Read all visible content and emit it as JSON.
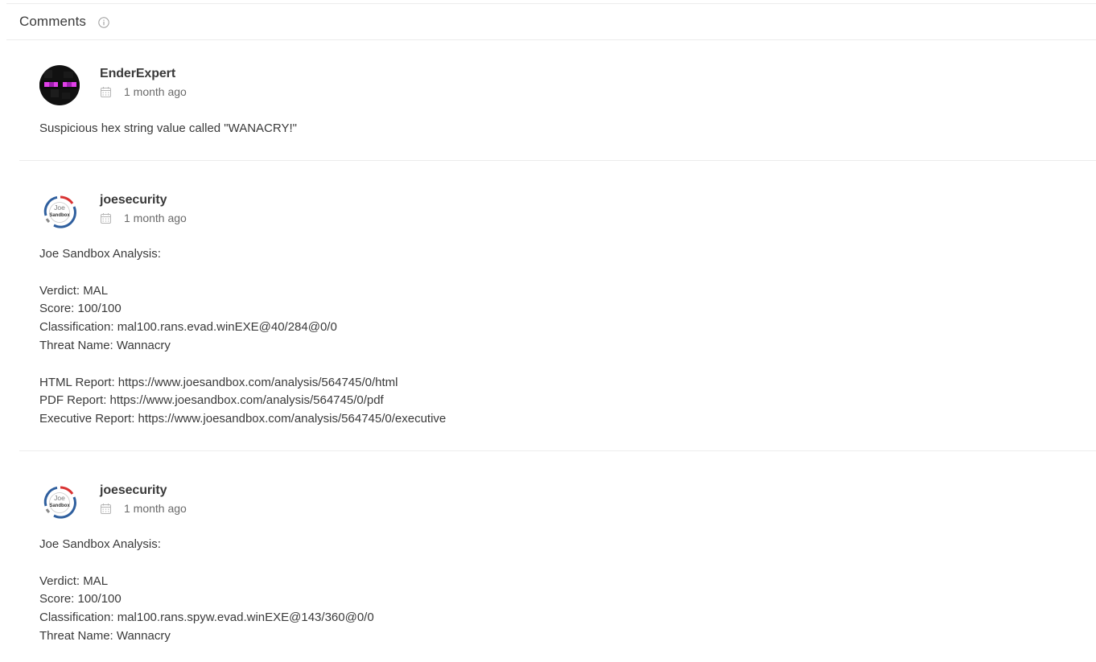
{
  "header": {
    "title": "Comments",
    "info_icon": "info-icon"
  },
  "comments": [
    {
      "author": "EnderExpert",
      "date": "1 month ago",
      "avatar": "enderman-avatar",
      "body": "Suspicious hex string value called \"WANACRY!\""
    },
    {
      "author": "joesecurity",
      "date": "1 month ago",
      "avatar": "joe-sandbox-logo",
      "avatar_text_top": "Joe",
      "avatar_text_bottom": "Sandbox",
      "body": "Joe Sandbox Analysis:\n\nVerdict: MAL\nScore: 100/100\nClassification: mal100.rans.evad.winEXE@40/284@0/0\nThreat Name: Wannacry\n\nHTML Report: https://www.joesandbox.com/analysis/564745/0/html\nPDF Report: https://www.joesandbox.com/analysis/564745/0/pdf\nExecutive Report: https://www.joesandbox.com/analysis/564745/0/executive"
    },
    {
      "author": "joesecurity",
      "date": "1 month ago",
      "avatar": "joe-sandbox-logo",
      "avatar_text_top": "Joe",
      "avatar_text_bottom": "Sandbox",
      "body": "Joe Sandbox Analysis:\n\nVerdict: MAL\nScore: 100/100\nClassification: mal100.rans.spyw.evad.winEXE@143/360@0/0\nThreat Name: Wannacry"
    }
  ]
}
